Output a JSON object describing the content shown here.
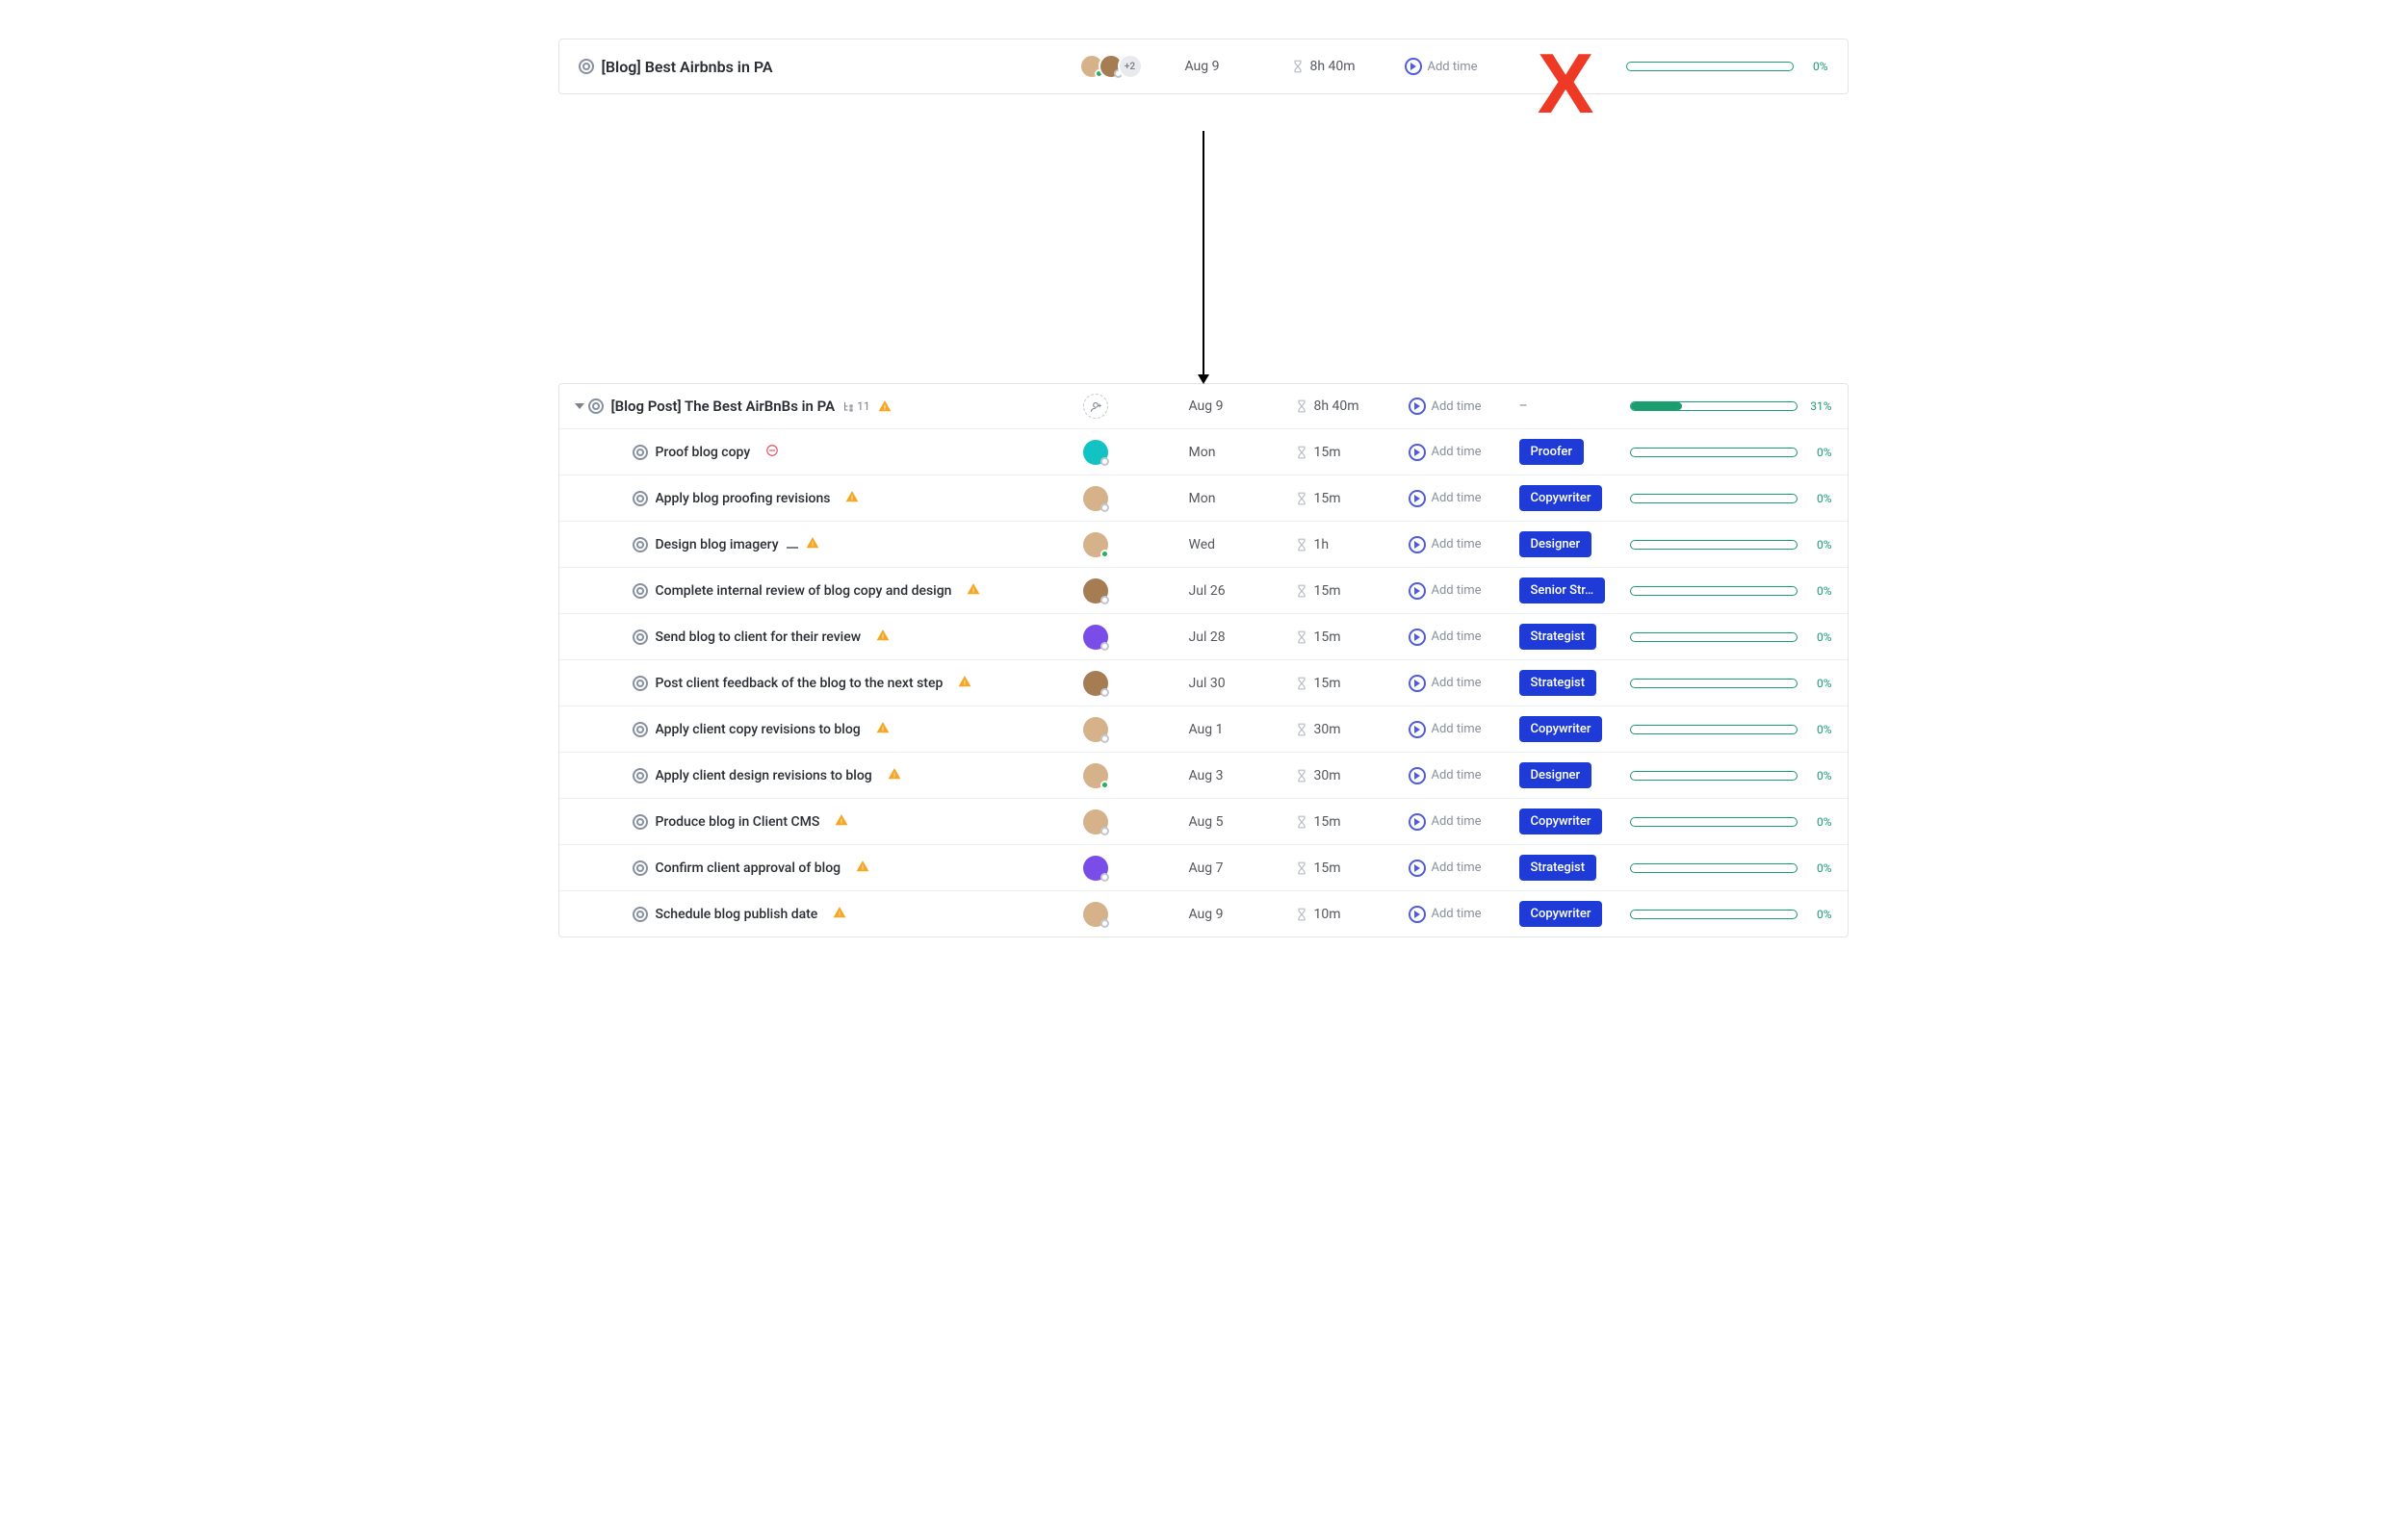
{
  "top_task": {
    "title": "[Blog] Best Airbnbs in PA",
    "assignee_more": "+2",
    "date": "Aug 9",
    "time": "8h 40m",
    "addtime_label": "Add time",
    "progress_label": "0%",
    "progress_pct": 0
  },
  "red_x": "X",
  "parent_task": {
    "title": "[Blog Post] The Best AirBnBs in PA",
    "subtask_count": "11",
    "date": "Aug 9",
    "time": "8h 40m",
    "addtime_label": "Add time",
    "role_label": "–",
    "progress_label": "31%",
    "progress_pct": 31
  },
  "subtasks": [
    {
      "title": "Proof blog copy",
      "icon_after": "blocked",
      "date": "Mon",
      "time": "15m",
      "addtime_label": "Add time",
      "role": "Proofer",
      "progress_label": "0%",
      "progress_pct": 0,
      "avatar_color": "#13c2c2",
      "status": "white"
    },
    {
      "title": "Apply blog proofing revisions",
      "icon_after": "warn",
      "date": "Mon",
      "time": "15m",
      "addtime_label": "Add time",
      "role": "Copywriter",
      "progress_label": "0%",
      "progress_pct": 0,
      "avatar_color": "#d6b28a",
      "status": "white"
    },
    {
      "title": "Design blog imagery",
      "icon_mid": "dash",
      "icon_after": "warn",
      "date": "Wed",
      "time": "1h",
      "addtime_label": "Add time",
      "role": "Designer",
      "progress_label": "0%",
      "progress_pct": 0,
      "avatar_color": "#d6b28a",
      "status": "green"
    },
    {
      "title": "Complete internal review of blog copy and design",
      "icon_after": "warn",
      "date": "Jul 26",
      "time": "15m",
      "addtime_label": "Add time",
      "role": "Senior Str…",
      "progress_label": "0%",
      "progress_pct": 0,
      "avatar_color": "#a67c52",
      "status": "white"
    },
    {
      "title": "Send blog to client for their review",
      "icon_after": "warn",
      "date": "Jul 28",
      "time": "15m",
      "addtime_label": "Add time",
      "role": "Strategist",
      "progress_label": "0%",
      "progress_pct": 0,
      "avatar_color": "#7b4de8",
      "status": "white"
    },
    {
      "title": "Post client feedback of the blog to the next step",
      "icon_after": "warn",
      "date": "Jul 30",
      "time": "15m",
      "addtime_label": "Add time",
      "role": "Strategist",
      "progress_label": "0%",
      "progress_pct": 0,
      "avatar_color": "#a67c52",
      "status": "white"
    },
    {
      "title": "Apply client copy revisions to blog",
      "icon_after": "warn",
      "date": "Aug 1",
      "time": "30m",
      "addtime_label": "Add time",
      "role": "Copywriter",
      "progress_label": "0%",
      "progress_pct": 0,
      "avatar_color": "#d6b28a",
      "status": "white"
    },
    {
      "title": "Apply client design revisions to blog",
      "icon_after": "warn",
      "date": "Aug 3",
      "time": "30m",
      "addtime_label": "Add time",
      "role": "Designer",
      "progress_label": "0%",
      "progress_pct": 0,
      "avatar_color": "#d6b28a",
      "status": "green"
    },
    {
      "title": "Produce blog in Client CMS",
      "icon_after": "warn",
      "date": "Aug 5",
      "time": "15m",
      "addtime_label": "Add time",
      "role": "Copywriter",
      "progress_label": "0%",
      "progress_pct": 0,
      "avatar_color": "#d6b28a",
      "status": "white"
    },
    {
      "title": "Confirm client approval of blog",
      "icon_after": "warn",
      "date": "Aug 7",
      "time": "15m",
      "addtime_label": "Add time",
      "role": "Strategist",
      "progress_label": "0%",
      "progress_pct": 0,
      "avatar_color": "#7b4de8",
      "status": "white"
    },
    {
      "title": "Schedule blog publish date",
      "icon_after": "warn",
      "date": "Aug 9",
      "time": "10m",
      "addtime_label": "Add time",
      "role": "Copywriter",
      "progress_label": "0%",
      "progress_pct": 0,
      "avatar_color": "#d6b28a",
      "status": "white"
    }
  ]
}
